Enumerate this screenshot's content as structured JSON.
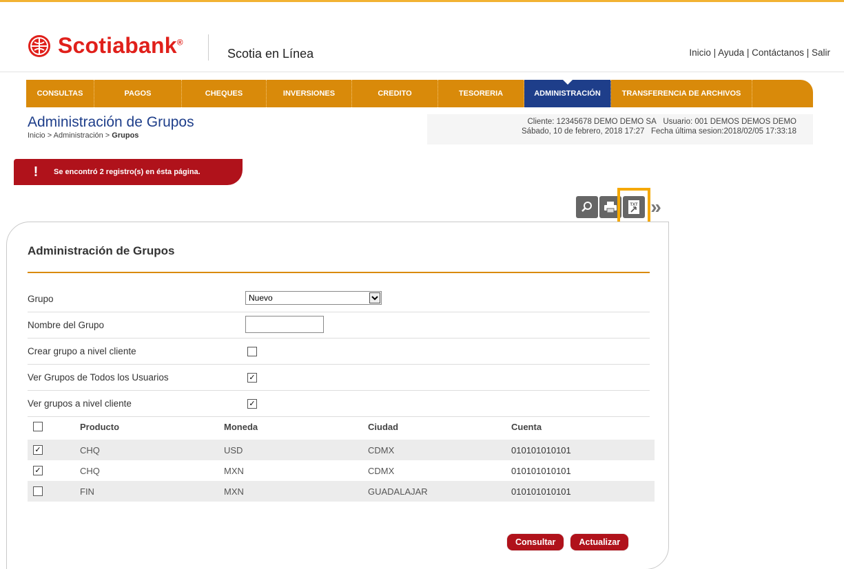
{
  "brand": {
    "name": "Scotiabank",
    "reg": "®",
    "app_name": "Scotia en Línea",
    "color": "#e0201b"
  },
  "top_links": [
    "Inicio",
    "Ayuda",
    "Contáctanos",
    "Salir"
  ],
  "nav": {
    "items": [
      {
        "label": "CONSULTAS"
      },
      {
        "label": "PAGOS"
      },
      {
        "label": "CHEQUES"
      },
      {
        "label": "INVERSIONES"
      },
      {
        "label": "CREDITO"
      },
      {
        "label": "TESORERIA"
      },
      {
        "label": "ADMINISTRACIÓN",
        "active": true
      },
      {
        "label": "TRANSFERENCIA DE ARCHIVOS"
      }
    ],
    "color": "#d98a0a",
    "active_color": "#1e3e8a"
  },
  "page": {
    "title": "Administración de Grupos",
    "breadcrumb_prefix": "Inicio > Administración > ",
    "breadcrumb_current": "Grupos"
  },
  "session": {
    "client": "Cliente: 12345678 DEMO DEMO SA",
    "user": "Usuario: 001 DEMOS DEMOS DEMO",
    "date": "Sábado, 10 de febrero, 2018 17:27",
    "last_session": "Fecha última sesion:2018/02/05 17:33:18"
  },
  "alert": {
    "icon": "exclamation-icon",
    "text": "Se encontró 2 registro(s) en ésta página."
  },
  "actions": [
    {
      "name": "search-icon"
    },
    {
      "name": "print-icon"
    },
    {
      "name": "txt-export-icon",
      "label": "TXT"
    },
    {
      "name": "double-chevron-right-icon"
    }
  ],
  "card": {
    "title": "Administración de Grupos",
    "fields": {
      "grupo": {
        "label": "Grupo",
        "value": "Nuevo"
      },
      "nombre": {
        "label": "Nombre del Grupo",
        "value": ""
      },
      "crear_cliente": {
        "label": "Crear grupo a nivel cliente",
        "checked": false
      },
      "ver_todos": {
        "label": "Ver Grupos de Todos los Usuarios",
        "checked": true
      },
      "ver_cliente": {
        "label": "Ver grupos a nivel cliente",
        "checked": true
      }
    },
    "table": {
      "columns": [
        "Producto",
        "Moneda",
        "Ciudad",
        "Cuenta"
      ],
      "select_all_checked": false,
      "rows": [
        {
          "checked": true,
          "producto": "CHQ",
          "moneda": "USD",
          "ciudad": "CDMX",
          "cuenta": "010101010101"
        },
        {
          "checked": true,
          "producto": "CHQ",
          "moneda": "MXN",
          "ciudad": "CDMX",
          "cuenta": "010101010101"
        },
        {
          "checked": false,
          "producto": "FIN",
          "moneda": "MXN",
          "ciudad": "GUADALAJAR",
          "cuenta": "010101010101"
        }
      ]
    },
    "buttons": {
      "consultar": "Consultar",
      "actualizar": "Actualizar"
    }
  }
}
